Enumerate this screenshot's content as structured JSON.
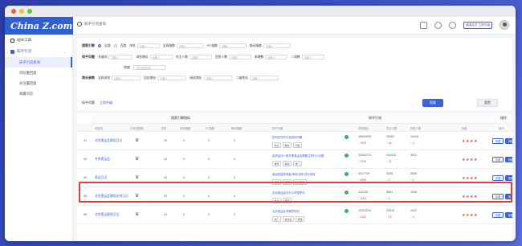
{
  "window_controls": [
    "close",
    "minimize",
    "maximize"
  ],
  "logo": "China Z.com",
  "topbar": {
    "breadcrumb": "知乎引流查询",
    "icons": [
      "screen-icon",
      "bell-icon",
      "message-icon"
    ],
    "vip_tag": "最高会员 立即升级"
  },
  "sidebar": {
    "groups": [
      {
        "label": "站长工具",
        "icon": "tool-icon"
      },
      {
        "label": "知乎引流",
        "icon": "zhihu-icon",
        "expanded": true
      }
    ],
    "items": [
      {
        "label": "知乎引流查询",
        "active": true
      },
      {
        "label": "浏览量回复"
      },
      {
        "label": "关注量回复"
      },
      {
        "label": "收藏问答"
      }
    ]
  },
  "filters": {
    "row1": {
      "label": "搜索引擎",
      "options": [
        "全部",
        "百度"
      ],
      "fields": [
        "排名",
        "全网指数",
        "PC指数",
        "移动指数"
      ],
      "placeholder": "请输入"
    },
    "row2": {
      "label": "知乎问题",
      "fields": [
        "关键词",
        "浏览增长",
        "关注人数",
        "回答人数",
        "新增数",
        "二排数"
      ],
      "placeholder": "请输入"
    },
    "row3": {
      "label": "热度",
      "select": "下拉选项内容"
    },
    "row4": {
      "label": "增长参数",
      "fields": [
        "全网浏览",
        "回应增长",
        "阅读增长",
        "二级增长"
      ],
      "placeholder": "请输入"
    },
    "links": [
      "知乎问题",
      "立即升级"
    ],
    "search_button": "搜索",
    "reset_button": "重置"
  },
  "table": {
    "group_seq": "序号",
    "group_search": "搜索引擎指标",
    "group_zhihu": "知乎引流",
    "group_ops": "操作",
    "columns": [
      "关键词",
      "已完成数据",
      "排名",
      "全网指数",
      "PC指数",
      "移动指数",
      "知乎问题",
      "浏览增长",
      "关注人数",
      "回答人数",
      "热度",
      "操作"
    ],
    "rows": [
      {
        "seq": "01",
        "keyword": "北京奥运会赛程日记",
        "rank": "29",
        "idx": "0",
        "pc": "0",
        "mobile": "0",
        "title": "如何在知乎中找到好问题",
        "tags": [
          "热点",
          "精彩",
          "问答"
        ],
        "views": "18604053",
        "views_delta": "↑ 2933",
        "follows": "28381",
        "follows_delta": "↑ 24",
        "answers": "10444",
        "answers_delta": "↑ 3",
        "heat": "★★★★"
      },
      {
        "seq": "02",
        "keyword": "冬季奥运会",
        "rank": "44",
        "idx": "0",
        "pc": "0",
        "mobile": "0",
        "title": "高清运动一般冬季奥运会需要注意什么问题",
        "tags": [
          "推荐",
          "精选",
          "热门"
        ],
        "views": "22422274",
        "views_delta": "↑ 3226",
        "follows": "241023",
        "follows_delta": "↑ 76",
        "answers": "3021",
        "answers_delta": "",
        "heat": "★★★★"
      },
      {
        "seq": "03",
        "keyword": "奥运日记",
        "rank": "34",
        "idx": "0",
        "pc": "0",
        "mobile": "0",
        "title": "奥运首金获得者 杨倩 如何 成为冠军",
        "tags": [
          "奥运",
          "冠军",
          "热门话题"
        ],
        "views": "4417729",
        "views_delta": "↑ 8999",
        "follows": "9259",
        "follows_delta": "↑ 2",
        "answers": "6345",
        "answers_delta": "↑ 1",
        "heat": "★★★★"
      },
      {
        "seq": "04",
        "keyword": "北京奥运会赛程安排日记",
        "rank": "53",
        "idx": "0",
        "pc": "0",
        "mobile": "0",
        "title": "北京奥运会在什么时候举办",
        "tags": [
          "奥运",
          "赛程"
        ],
        "views": "441228",
        "views_delta": "↑ 1004",
        "follows": "3891",
        "follows_delta": "↑ 3",
        "answers": "1028",
        "answers_delta": "",
        "heat": "★★★★"
      },
      {
        "seq": "05",
        "keyword": "北京奥运赛程日记",
        "rank": "24",
        "idx": "0",
        "pc": "0",
        "mobile": "0",
        "title": "北京奥运会有哪些项目",
        "tags": [
          "热门",
          "奥运会",
          "赛程"
        ],
        "views": "11224234",
        "views_delta": "↑ 4332",
        "follows": "23015",
        "follows_delta": "↑ 13",
        "answers": "1022",
        "answers_delta": "↑ 3",
        "heat": "★★★★"
      }
    ],
    "view_label": "查看",
    "add_label": "收藏"
  },
  "colors": {
    "accent": "#3c62d8",
    "highlight": "#e0403a",
    "up": "#e0473d"
  }
}
